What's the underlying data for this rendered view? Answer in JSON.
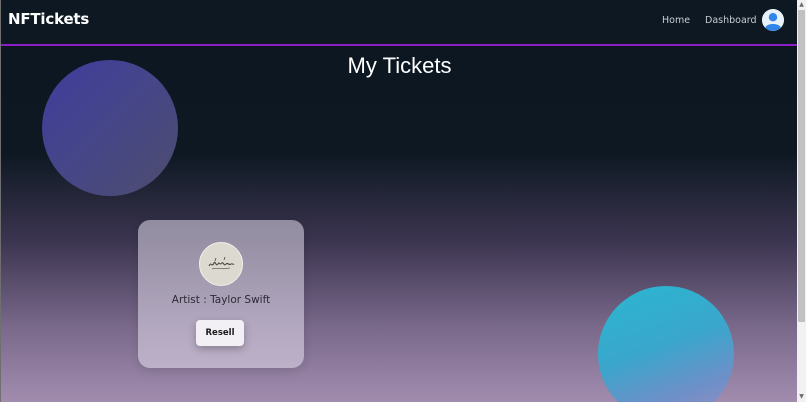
{
  "navbar": {
    "brand": "NFTickets",
    "links": [
      {
        "label": "Home"
      },
      {
        "label": "Dashboard"
      }
    ],
    "avatar_icon": "user-avatar-icon"
  },
  "main": {
    "title": "My Tickets"
  },
  "tickets": [
    {
      "artist_label": "Artist : Taylor Swift",
      "resell_label": "Resell",
      "image_icon": "signature-image"
    }
  ],
  "colors": {
    "navbar_bg": "#0d1822",
    "navbar_border": "#8c1fc4",
    "bubble_purple": "#3f3c9d",
    "bubble_cyan": "#2ab7d0"
  }
}
